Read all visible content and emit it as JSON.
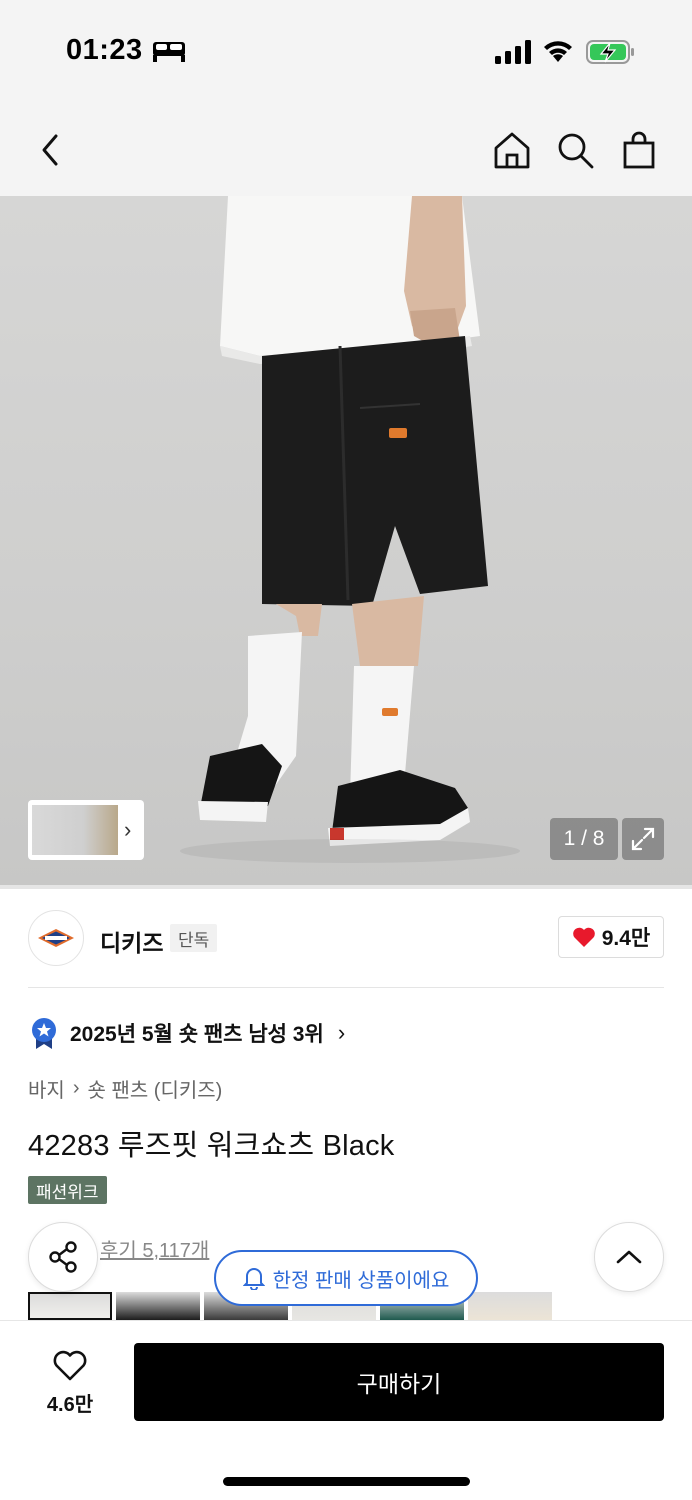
{
  "status_bar": {
    "time": "01:23",
    "icons": [
      "bed-icon",
      "signal-icon",
      "wifi-icon",
      "battery-charging-icon"
    ],
    "battery_color": "#35c759"
  },
  "nav": {
    "icons": [
      "back-arrow-icon",
      "home-icon",
      "search-icon",
      "shopping-bag-icon"
    ]
  },
  "gallery": {
    "counter": "1 / 8",
    "current_index": 1,
    "total": 8
  },
  "brand": {
    "name": "디키즈",
    "badge": "단독",
    "likes": "9.4만"
  },
  "ranking": {
    "text": "2025년 5월 숏 팬츠 남성 3위",
    "chevron": "›"
  },
  "breadcrumb": {
    "level1": "바지",
    "separator": "›",
    "level2": "숏 팬츠 (디키즈)"
  },
  "product": {
    "title": "42283 루즈핏 워크쇼츠 Black",
    "tag": "패션위크",
    "review_link": "후기 5,117개"
  },
  "notice": {
    "limited": "한정 판매 상품이에요"
  },
  "color_options": [
    {
      "color": "#f0efec",
      "selected": true
    },
    {
      "color": "#1d1d1d",
      "selected": false
    },
    {
      "color": "#3a3a3a",
      "selected": false
    },
    {
      "color": "#e7e6e2",
      "selected": false
    },
    {
      "color": "#1f5a4f",
      "selected": false
    },
    {
      "color": "#ece4d6",
      "selected": false
    }
  ],
  "bottom": {
    "wish_count": "4.6만",
    "buy_label": "구매하기"
  },
  "colors": {
    "accent_blue": "#2f6bd8",
    "heart_red": "#e8192c",
    "tag_green": "#5d7463",
    "buy_black": "#000000"
  }
}
